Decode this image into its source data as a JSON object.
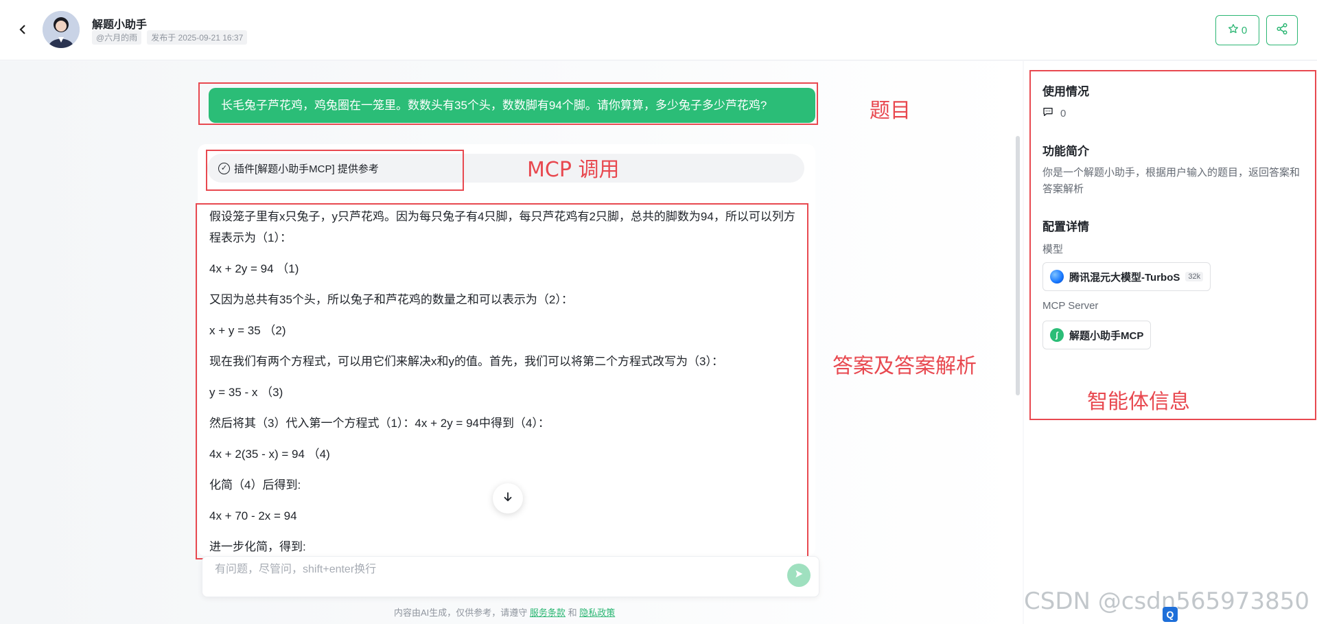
{
  "header": {
    "back_icon": "chevron-left-icon",
    "app_title": "解题小助手",
    "author": "@六月的雨",
    "published": "发布于 2025-09-21 16:37",
    "favorite_count": "0",
    "accent": "#2bb673"
  },
  "chat": {
    "question": "长毛兔子芦花鸡，鸡兔圈在一笼里。数数头有35个头，数数脚有94个脚。请你算算，多少兔子多少芦花鸡?",
    "plugin_text": "插件[解题小助手MCP] 提供参考",
    "answer": [
      "假设笼子里有x只兔子，y只芦花鸡。因为每只兔子有4只脚，每只芦花鸡有2只脚，总共的脚数为94，所以可以列方程表示为（1）：",
      "4x + 2y = 94 （1)",
      "又因为总共有35个头，所以兔子和芦花鸡的数量之和可以表示为（2）：",
      "x + y = 35 （2)",
      "现在我们有两个方程式，可以用它们来解决x和y的值。首先，我们可以将第二个方程式改写为（3）：",
      "y = 35 - x （3)",
      "然后将其（3）代入第一个方程式（1）：4x + 2y = 94中得到（4）：",
      "4x + 2(35 - x) = 94 （4)",
      "化简（4）后得到:",
      "4x + 70 - 2x = 94",
      "进一步化简，得到:"
    ],
    "input_placeholder": "有问题，尽管问，shift+enter换行",
    "disclaimer_prefix": "内容由AI生成，仅供参考，请遵守",
    "terms_link": "服务条款",
    "and": "和",
    "privacy_link": "隐私政策"
  },
  "annotations": {
    "question": "题目",
    "mcp": "MCP 调用",
    "answer": "答案及答案解析",
    "agent_info": "智能体信息"
  },
  "sidebar": {
    "usage_title": "使用情况",
    "comment_count": "0",
    "intro_title": "功能简介",
    "intro_text": "你是一个解题小助手，根据用户输入的题目，返回答案和答案解析",
    "config_title": "配置详情",
    "model_label": "模型",
    "model_name": "腾讯混元大模型-TurboS",
    "model_badge": "32k",
    "mcp_label": "MCP Server",
    "mcp_name": "解题小助手MCP"
  },
  "watermark": "CSDN @csdn565973850"
}
